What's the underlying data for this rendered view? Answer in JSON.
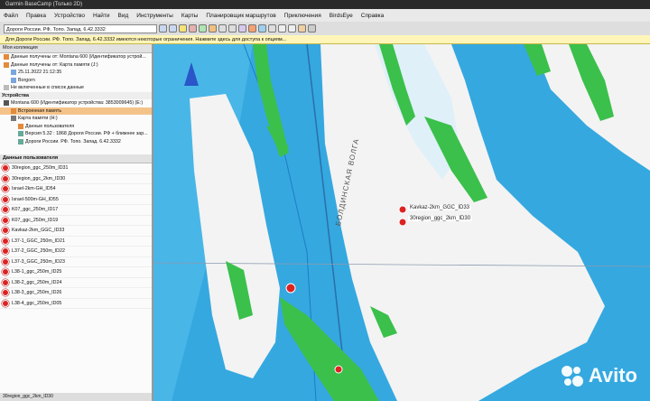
{
  "window": {
    "title": "Garmin BaseCamp (Только 2D)"
  },
  "menu": [
    "Файл",
    "Правка",
    "Устройство",
    "Найти",
    "Вид",
    "Инструменты",
    "Карты",
    "Планировщик маршрутов",
    "Приключения",
    "BirdsEye",
    "Справка"
  ],
  "toolbar": {
    "map_product": "Дороги России. РФ. Топо. Запад. 6.42.3332"
  },
  "infobar": {
    "message": "Для Дороги России. РФ. Топо. Запад. 6.42.3332 имеются некоторые ограничения. Нажмите здесь для доступа к опциям..."
  },
  "library": {
    "header": "Моя коллекция",
    "items": [
      "Данные получены от: Montana 600 (Идентификатор устрой...",
      "Данные получены от: Карта памяти (J:)",
      "25.11.2022 21:12:35",
      "Borgorn",
      "Не включенные в список данные"
    ],
    "devices_header": "Устройства",
    "device_items": [
      "Montana 600 (Идентификатор устройства: 3853009645) (E:)",
      "Встроенная память",
      "Карта памяти (H:)",
      "Данные пользователя",
      "Версия 5.32 : 1868 Дороги России. РФ + ближнее зар...",
      "Дороги России. РФ. Топо. Запад. 6.42.3332"
    ]
  },
  "user_data": {
    "header": "Данные пользователя",
    "rows": [
      "30region_ggc_250m_ID31",
      "30region_ggc_2km_ID30",
      "Israel-2km-GH_ID54",
      "Israel-500m-GH_ID55",
      "K07_ggc_250m_ID17",
      "K07_ggc_250m_ID19",
      "Kavkaz-2km_GGC_ID33",
      "L37-1_GGC_250m_ID21",
      "L37-2_GGC_250m_ID22",
      "L37-3_GGC_250m_ID23",
      "L38-1_ggc_250m_ID25",
      "L38-2_ggc_250m_ID24",
      "L38-3_ggc_250m_ID26",
      "L38-4_ggc_250m_ID05"
    ],
    "status": "30region_ggc_2km_ID30"
  },
  "map": {
    "waypoints": [
      "Kavkaz-2km_GGC_ID33",
      "30region_ggc_2km_ID30"
    ],
    "place_label": "БОЛДИНСКАЯ ВОЛГА",
    "colors": {
      "water": "#35a8e0",
      "land": "#f3f3f3",
      "vegetation": "#3bc04b"
    }
  },
  "watermark": {
    "text": "Avito"
  }
}
